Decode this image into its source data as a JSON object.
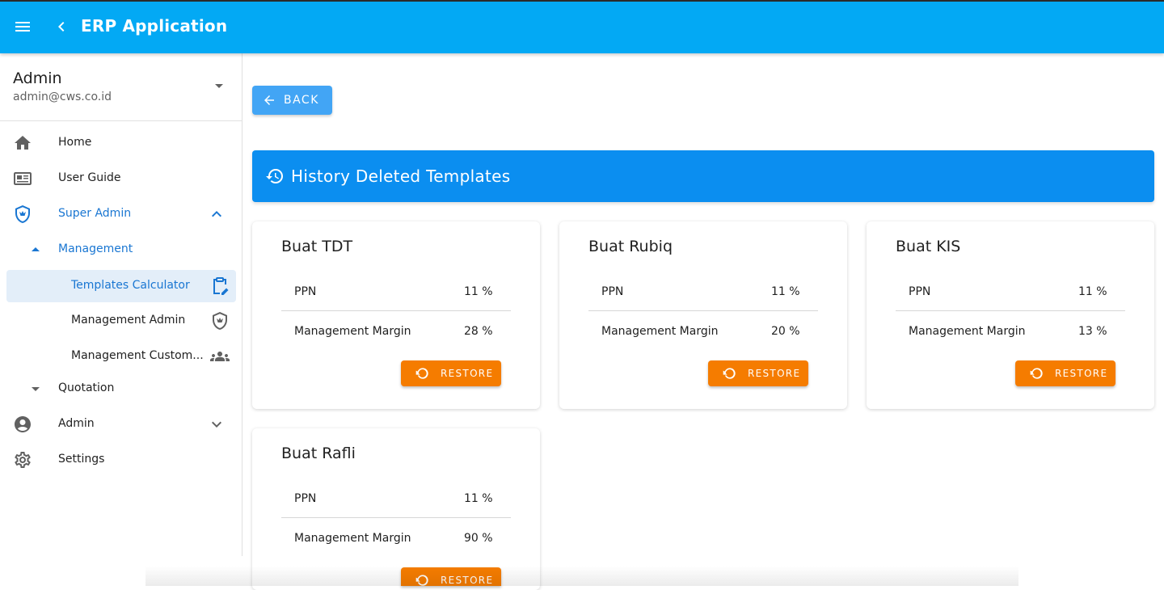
{
  "app": {
    "title": "ERP Application"
  },
  "user": {
    "name": "Admin",
    "email": "admin@cws.co.id"
  },
  "nav": {
    "home": "Home",
    "user_guide": "User Guide",
    "super_admin": "Super Admin",
    "management": "Management",
    "templates_calculator": "Templates Calculator",
    "management_admin": "Management Admin",
    "management_customer": "Management Custom...",
    "quotation": "Quotation",
    "admin": "Admin",
    "settings": "Settings"
  },
  "main": {
    "back_label": "BACK",
    "banner_title": "History Deleted Templates",
    "restore_label": "RESTORE",
    "cards": [
      {
        "title": "Buat TDT",
        "rows": [
          {
            "key": "PPN",
            "value": "11 %"
          },
          {
            "key": "Management Margin",
            "value": "28 %"
          }
        ]
      },
      {
        "title": "Buat Rubiq",
        "rows": [
          {
            "key": "PPN",
            "value": "11 %"
          },
          {
            "key": "Management Margin",
            "value": "20 %"
          }
        ]
      },
      {
        "title": "Buat KIS",
        "rows": [
          {
            "key": "PPN",
            "value": "11 %"
          },
          {
            "key": "Management Margin",
            "value": "13 %"
          }
        ]
      },
      {
        "title": "Buat Rafli",
        "rows": [
          {
            "key": "PPN",
            "value": "11 %"
          },
          {
            "key": "Management Margin",
            "value": "90 %"
          }
        ]
      }
    ]
  },
  "colors": {
    "appbar": "#03a9f4",
    "banner": "#0b8ef0",
    "back_button": "#42a5f5",
    "restore_button": "#f57c00",
    "active": "#1976d2"
  }
}
